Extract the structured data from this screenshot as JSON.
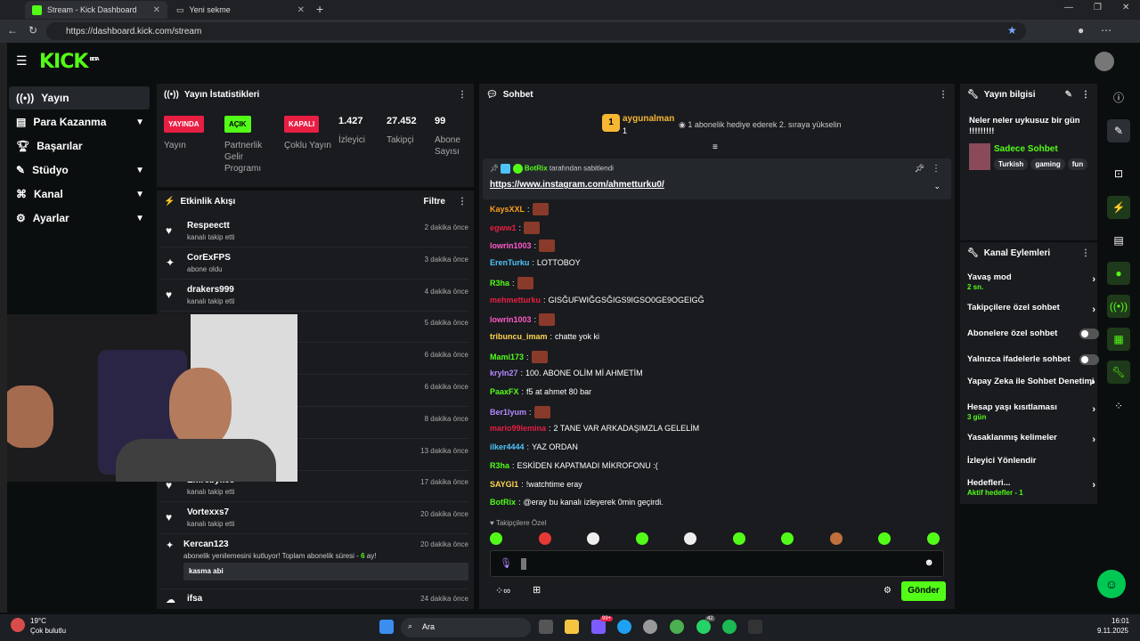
{
  "browser": {
    "tabs": [
      {
        "title": "Stream - Kick Dashboard"
      },
      {
        "title": "Yeni sekme"
      }
    ],
    "url": "https://dashboard.kick.com/stream"
  },
  "header": {
    "logo": "KICK",
    "logo_badge": "BETA"
  },
  "sidebar": {
    "items": [
      {
        "label": "Yayın"
      },
      {
        "label": "Para Kazanma"
      },
      {
        "label": "Başarılar"
      },
      {
        "label": "Stüdyo"
      },
      {
        "label": "Kanal"
      },
      {
        "label": "Ayarlar"
      }
    ]
  },
  "stats": {
    "title": "Yayın İstatistikleri",
    "cols": [
      {
        "badge": "YAYINDA",
        "label": "Yayın",
        "color": "#e91e43"
      },
      {
        "badge": "AÇIK",
        "label": "Partnerlik Gelir Programı",
        "color": "#53fc18"
      },
      {
        "badge": "KAPALI",
        "label": "Çoklu Yayın",
        "color": "#e91e43"
      },
      {
        "value": "1.427",
        "label": "İzleyici"
      },
      {
        "value": "27.452",
        "label": "Takipçi"
      },
      {
        "value": "99",
        "label": "Abone Sayısı"
      }
    ]
  },
  "activity": {
    "title": "Etkinlik Akışı",
    "filter": "Filtre",
    "rows": [
      {
        "name": "Respeectt",
        "sub": "kanalı takip etti",
        "time": "2 dakika önce",
        "icon": "heart-icon"
      },
      {
        "name": "CorExFPS",
        "sub": "abone oldu",
        "time": "3 dakika önce",
        "icon": "sparkle-icon"
      },
      {
        "name": "drakers999",
        "sub": "kanalı takip etti",
        "time": "4 dakika önce",
        "icon": "heart-icon"
      },
      {
        "name": "",
        "sub": "",
        "time": "5 dakika önce",
        "icon": "heart-icon"
      },
      {
        "name": "",
        "sub": "",
        "time": "6 dakika önce",
        "icon": "heart-icon"
      },
      {
        "name": "",
        "sub": "",
        "time": "6 dakika önce",
        "icon": "heart-icon"
      },
      {
        "name": "",
        "sub": "",
        "time": "8 dakika önce",
        "icon": "heart-icon"
      },
      {
        "name": "",
        "sub": "",
        "time": "13 dakika önce",
        "icon": "heart-icon"
      },
      {
        "name": "Emrebyk08",
        "sub": "kanalı takip etti",
        "time": "17 dakika önce",
        "icon": "heart-icon"
      },
      {
        "name": "Vortexxs7",
        "sub": "kanalı takip etti",
        "time": "20 dakika önce",
        "icon": "heart-icon"
      }
    ],
    "resub": {
      "name": "Kercan123",
      "time": "20 dakika önce",
      "text_a": "abonelik yenilemesini kutluyor! Toplam abonelik süresi - ",
      "months": "6",
      "text_b": " ay!",
      "message": "kasma abi"
    },
    "last": {
      "name": "ifsa",
      "time": "24 dakika önce"
    }
  },
  "chat": {
    "title": "Sohbet",
    "top_gifter": {
      "name": "aygunalman",
      "rank": "1",
      "count": "1"
    },
    "gift_text": "1 abonelik hediye ederek 2. sıraya yükselin",
    "pinned": {
      "by": "BotRix",
      "label": "tarafından sabitlendi",
      "link": "https://www.instagram.com/ahmetturku0/"
    },
    "messages": [
      {
        "user": "KaysXXL",
        "color": "#ff9f1c",
        "text": "",
        "emote": true
      },
      {
        "user": "egww1",
        "color": "#e91e43",
        "text": "",
        "emote": true
      },
      {
        "user": "lowrin1003",
        "color": "#ff5ac8",
        "text": "",
        "emote": true
      },
      {
        "user": "ErenTurku",
        "color": "#4fc3f7",
        "text": "LOTTOBOY",
        "emote": false
      },
      {
        "user": "R3ha",
        "color": "#53fc18",
        "text": "",
        "emote": true
      },
      {
        "user": "mehmetturku",
        "color": "#e91e43",
        "text": "GISĞUFWIĞGSĞIGS9IGSO0GE9OGEIGĞ",
        "emote": false
      },
      {
        "user": "lowrin1003",
        "color": "#ff5ac8",
        "text": "",
        "emote": true
      },
      {
        "user": "tribuncu_imam",
        "color": "#ffd54f",
        "text": "chatte yok ki",
        "emote": false
      },
      {
        "user": "Mami173",
        "color": "#53fc18",
        "text": "",
        "emote": true
      },
      {
        "user": "kryln27",
        "color": "#b388ff",
        "text": "100. ABONE OLİM Mİ AHMETİM",
        "emote": false
      },
      {
        "user": "PaaxFX",
        "color": "#53fc18",
        "text": "f5 at ahmet 80 bar",
        "emote": false
      },
      {
        "user": "Ber1lyum",
        "color": "#b388ff",
        "text": "",
        "emote": true
      },
      {
        "user": "mario99lemina",
        "color": "#e91e43",
        "text": "2 TANE VAR ARKADAŞIMZLA GELELİM",
        "emote": false
      },
      {
        "user": "ilker4444",
        "color": "#4fc3f7",
        "text": "YAZ ORDAN",
        "emote": false
      },
      {
        "user": "R3ha",
        "color": "#53fc18",
        "text": "ESKİDEN KAPATMADI MİKROFONU :(",
        "emote": false
      },
      {
        "user": "SAYGI1",
        "color": "#ffd54f",
        "text": "!watchtime eray",
        "emote": false
      },
      {
        "user": "BotRix",
        "color": "#53fc18",
        "text": "@eray bu kanalı izleyerek 0min geçirdi.",
        "emote": false
      }
    ],
    "followers_only": "Takipçilere Özel",
    "send": "Gönder"
  },
  "info": {
    "title": "Yayın bilgisi",
    "stream_title": "Neler neler uykusuz bir gün !!!!!!!!!",
    "category": "Sadece Sohbet",
    "tags": [
      "Turkish",
      "gaming",
      "fun"
    ]
  },
  "actions": {
    "title": "Kanal Eylemleri",
    "items": [
      {
        "label": "Yavaş mod",
        "sub": "2 sn.",
        "kind": "chevron"
      },
      {
        "label": "Takipçilere özel sohbet",
        "sub": "",
        "kind": "chevron"
      },
      {
        "label": "Abonelere özel sohbet",
        "sub": "",
        "kind": "toggle"
      },
      {
        "label": "Yalnızca ifadelerle sohbet",
        "sub": "",
        "kind": "toggle"
      },
      {
        "label": "Yapay Zeka ile Sohbet Denetimi",
        "sub": "",
        "kind": "external"
      },
      {
        "label": "Hesap yaşı kısıtlaması",
        "sub": "3 gün",
        "kind": "chevron"
      },
      {
        "label": "Yasaklanmış kelimeler",
        "sub": "",
        "kind": "chevron"
      },
      {
        "label": "İzleyici Yönlendir",
        "sub": "",
        "kind": "none"
      },
      {
        "label": "Hedefleri...",
        "sub": "Aktif hedefler - 1",
        "kind": "chevron"
      }
    ]
  },
  "taskbar": {
    "weather_temp": "19°C",
    "weather_desc": "Çok bulutlu",
    "search": "Ara",
    "time": "16:01",
    "date": "9.11.2025",
    "badge_a": "99+",
    "badge_b": "42"
  },
  "colors": {
    "accent": "#53fc18",
    "live": "#e91e43",
    "panel": "#191b1f",
    "bg": "#0b0e0f"
  }
}
